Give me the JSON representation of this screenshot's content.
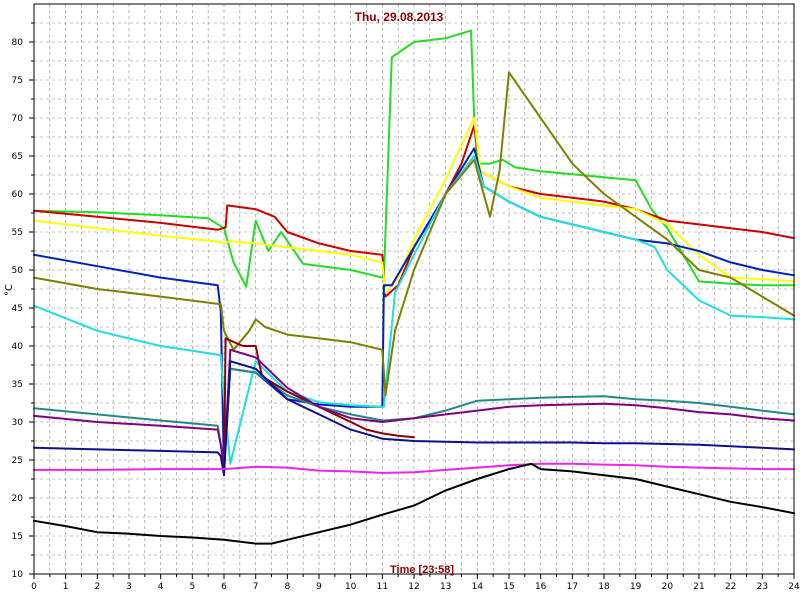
{
  "chart_data": {
    "type": "line",
    "title": "Thu, 29.08.2013",
    "xlabel": "Time [23:58]",
    "ylabel": "°C",
    "xlim": [
      0,
      24
    ],
    "ylim": [
      10,
      85
    ],
    "xticks": [
      0,
      1,
      2,
      3,
      4,
      5,
      6,
      7,
      8,
      9,
      10,
      11,
      12,
      13,
      14,
      15,
      16,
      17,
      18,
      19,
      20,
      21,
      22,
      23,
      24
    ],
    "yticks": [
      10,
      15,
      20,
      25,
      30,
      35,
      40,
      45,
      50,
      55,
      60,
      65,
      70,
      75,
      80
    ],
    "grid": true,
    "series": [
      {
        "color": "#22dd22",
        "x": [
          0,
          2,
          4,
          5.5,
          6,
          6.3,
          6.7,
          7,
          7.4,
          7.8,
          8.5,
          10,
          11,
          11.05,
          11.3,
          12,
          13,
          13.8,
          13.9,
          14,
          14.4,
          14.8,
          15.2,
          16,
          17,
          18,
          19,
          19.5,
          20,
          20.5,
          21,
          22,
          23,
          24
        ],
        "y": [
          57.8,
          57.6,
          57.2,
          56.8,
          55.5,
          51,
          47.8,
          56.5,
          52.5,
          55,
          50.8,
          50,
          49,
          49,
          78,
          80,
          80.5,
          81.5,
          70,
          64,
          64,
          64.5,
          63.5,
          63,
          62.6,
          62.2,
          61.8,
          58,
          55.5,
          52,
          48.5,
          48.2,
          48,
          48
        ]
      },
      {
        "color": "#cc0000",
        "x": [
          0,
          2,
          4,
          5.8,
          6.05,
          6.1,
          7,
          7.6,
          8,
          9,
          10,
          11,
          11.1,
          11.5,
          12,
          13,
          13.5,
          13.9,
          14.1,
          15,
          16,
          17,
          18,
          19,
          20,
          21,
          22,
          23,
          24
        ],
        "y": [
          57.8,
          57,
          56.2,
          55.3,
          55.6,
          58.5,
          58,
          57,
          55,
          53.5,
          52.5,
          52,
          46.5,
          48,
          53,
          60,
          64,
          69,
          63,
          61,
          60,
          59.5,
          59,
          58,
          56.5,
          56,
          55.5,
          55,
          54.2
        ]
      },
      {
        "color": "#ffff00",
        "x": [
          0,
          2,
          4,
          5.9,
          6,
          6.2,
          7,
          8,
          10,
          11,
          11.1,
          11.5,
          12,
          13,
          13.9,
          14.1,
          15,
          16,
          17,
          18,
          19,
          20,
          21,
          22,
          23,
          24
        ],
        "y": [
          56.5,
          55.5,
          54.5,
          53.7,
          53.5,
          53.8,
          53.5,
          53,
          52,
          51,
          47,
          49,
          54,
          62,
          70,
          63,
          61,
          59.5,
          59,
          58.5,
          58,
          56,
          52,
          49,
          48.8,
          48.5
        ]
      },
      {
        "color": "#0022bb",
        "x": [
          0,
          2,
          4,
          5.8,
          5.9,
          6,
          6.2,
          7,
          8,
          9,
          10,
          11,
          11.05,
          11.3,
          12,
          13,
          13.9,
          14.2,
          15,
          16,
          17,
          18,
          19,
          20,
          20.5,
          21,
          22,
          23,
          24
        ],
        "y": [
          52,
          50.5,
          49,
          48,
          44.5,
          23.5,
          37,
          36.5,
          33,
          32.3,
          32,
          32,
          48,
          48,
          53,
          60,
          66,
          61,
          59,
          57,
          56,
          55,
          54,
          53.5,
          53,
          52.5,
          51,
          50,
          49.3
        ]
      },
      {
        "color": "#22dddd",
        "x": [
          0,
          2,
          4,
          5.9,
          6,
          6.2,
          7,
          8,
          9,
          10,
          11,
          11.05,
          11.4,
          12,
          13,
          13.9,
          14.2,
          15,
          16,
          17,
          18,
          19,
          19.6,
          20,
          21,
          22,
          23,
          24
        ],
        "y": [
          45.3,
          42,
          40,
          38.8,
          33,
          24.5,
          38,
          34,
          32.6,
          32.2,
          32,
          32,
          47,
          52,
          60,
          65,
          61,
          59,
          57,
          56,
          55,
          54,
          53,
          50,
          46,
          44,
          43.8,
          43.5
        ]
      },
      {
        "color": "#808000",
        "x": [
          0,
          2,
          4,
          5.9,
          6,
          6.3,
          6.8,
          7,
          7.3,
          8,
          9,
          10,
          11,
          11.1,
          11.4,
          12,
          13,
          13.9,
          14.4,
          14.7,
          15,
          15.5,
          16,
          17,
          18,
          19,
          20,
          21,
          22,
          23,
          24
        ],
        "y": [
          49,
          47.5,
          46.5,
          45.5,
          42,
          39.5,
          42,
          43.5,
          42.5,
          41.5,
          41,
          40.5,
          39.5,
          33.5,
          42,
          50,
          60,
          64.5,
          57,
          63,
          76,
          73,
          70,
          64,
          60,
          57,
          54,
          50,
          49,
          46.5,
          44
        ]
      },
      {
        "color": "#8b0000",
        "x": [
          6,
          6.05,
          6.6,
          7,
          7.2,
          8,
          9,
          10,
          10.5,
          11,
          11.5,
          12
        ],
        "y": [
          23,
          41,
          40,
          40,
          36,
          34,
          32,
          30,
          29,
          28.5,
          28.2,
          28
        ]
      },
      {
        "color": "#228888",
        "x": [
          0,
          2,
          4,
          5.8,
          5.9,
          6,
          6.2,
          7,
          8,
          9,
          10,
          11,
          12,
          13,
          14,
          15,
          16,
          17,
          18,
          19,
          20,
          21,
          22,
          23,
          24
        ],
        "y": [
          31.8,
          31,
          30.2,
          29.5,
          27,
          24,
          37,
          36.5,
          33.5,
          32,
          31,
          30.2,
          30.5,
          31.5,
          32.8,
          33,
          33.2,
          33.3,
          33.4,
          33,
          32.8,
          32.5,
          32,
          31.5,
          31
        ]
      },
      {
        "color": "#800080",
        "x": [
          0,
          2,
          4,
          5.8,
          5.9,
          6,
          6.2,
          7,
          8,
          9,
          10,
          11,
          12,
          13,
          14,
          15,
          16,
          17,
          18,
          19,
          20,
          21,
          22,
          23,
          24
        ],
        "y": [
          30.8,
          30,
          29.5,
          29,
          27,
          24,
          39.5,
          38.5,
          34.5,
          32,
          30.5,
          30,
          30.5,
          31,
          31.5,
          32,
          32.2,
          32.3,
          32.4,
          32.2,
          31.8,
          31.3,
          31,
          30.5,
          30.2
        ]
      },
      {
        "color": "#101088",
        "x": [
          0,
          2,
          4,
          5.8,
          5.9,
          6,
          6.2,
          7,
          8,
          9,
          10,
          11,
          12,
          13,
          14,
          15,
          16,
          17,
          18,
          19,
          20,
          21,
          22,
          23,
          24
        ],
        "y": [
          26.6,
          26.4,
          26.2,
          26,
          25.5,
          23,
          38,
          37,
          33,
          31,
          29,
          27.8,
          27.5,
          27.4,
          27.3,
          27.3,
          27.3,
          27.3,
          27.2,
          27.2,
          27.1,
          27,
          26.8,
          26.6,
          26.4
        ]
      },
      {
        "color": "#ee22ee",
        "x": [
          0,
          2,
          4,
          6,
          7,
          8,
          9,
          10,
          11,
          12,
          13,
          14,
          15,
          16,
          17,
          18,
          19,
          20,
          21,
          22,
          23,
          24
        ],
        "y": [
          23.7,
          23.7,
          23.8,
          23.8,
          24.1,
          24,
          23.6,
          23.5,
          23.3,
          23.4,
          23.7,
          24,
          24.3,
          24.5,
          24.5,
          24.4,
          24.3,
          24.1,
          24,
          23.9,
          23.8,
          23.8
        ]
      },
      {
        "color": "#000000",
        "x": [
          0,
          1,
          2,
          3,
          4,
          5,
          6,
          7,
          7.5,
          8,
          9,
          10,
          11,
          12,
          13,
          14,
          15,
          15.7,
          16,
          17,
          18,
          19,
          20,
          21,
          22,
          23,
          24
        ],
        "y": [
          17,
          16.3,
          15.5,
          15.3,
          15,
          14.8,
          14.5,
          14,
          14,
          14.5,
          15.5,
          16.5,
          17.8,
          19,
          21,
          22.5,
          23.8,
          24.5,
          23.8,
          23.5,
          23,
          22.5,
          21.5,
          20.5,
          19.5,
          18.8,
          18
        ]
      }
    ]
  }
}
